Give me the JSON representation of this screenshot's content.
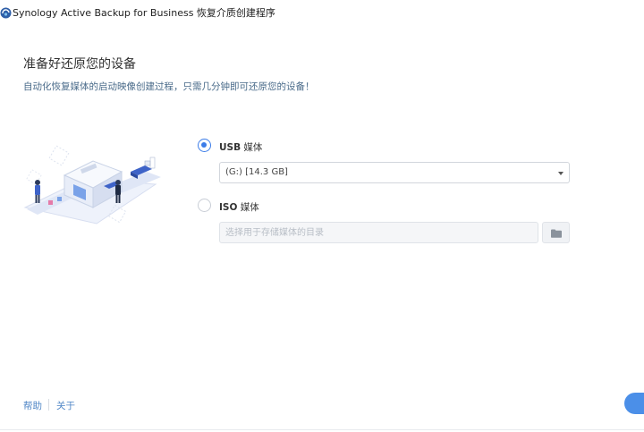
{
  "window": {
    "title": "Synology Active Backup for Business 恢复介质创建程序",
    "app_icon": "synology-abb-icon"
  },
  "header": {
    "title": "准备好还原您的设备",
    "subtitle": "自动化恢复媒体的启动映像创建过程，只需几分钟即可还原您的设备！"
  },
  "options": {
    "usb": {
      "label_bold": "USB",
      "label_rest": " 媒体",
      "selected": true,
      "drive_value": "(G:) [14.3 GB]"
    },
    "iso": {
      "label_bold": "ISO",
      "label_rest": " 媒体",
      "selected": false,
      "path_value": "",
      "path_placeholder": "选择用于存储媒体的目录",
      "browse_icon": "folder-icon"
    }
  },
  "footer": {
    "help_label": "帮助",
    "about_label": "关于"
  },
  "colors": {
    "accent": "#3d7de8",
    "link": "#4f86c6",
    "button": "#4b8fe8"
  }
}
